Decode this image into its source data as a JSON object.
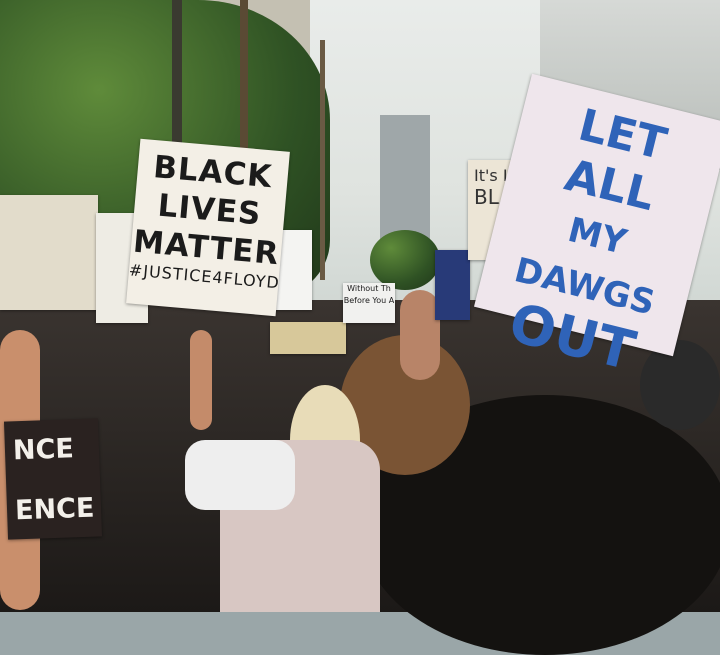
{
  "scene": {
    "description_colors": {
      "sky": "#e9ecea",
      "foliage": "#2f5224",
      "crowd": "#1c1917",
      "sign_blue": "#2f63b8"
    }
  },
  "signs": {
    "blm": {
      "line1": "BLACK",
      "line2": "LIVES",
      "line3": "MATTER",
      "hashtag": "#JUSTICE4FLOYD"
    },
    "dawgs": {
      "line1": "LET",
      "line2": "ALL",
      "line3": "MY DAWGS",
      "line4": "OUT"
    },
    "partial_right": {
      "line1": "It's Lo",
      "line2": "BLAC"
    },
    "small_center": {
      "line1": "Without Th",
      "line2": "Before You A"
    },
    "bottom_left": {
      "line1": "NCE",
      "line2": "ENCE"
    }
  }
}
